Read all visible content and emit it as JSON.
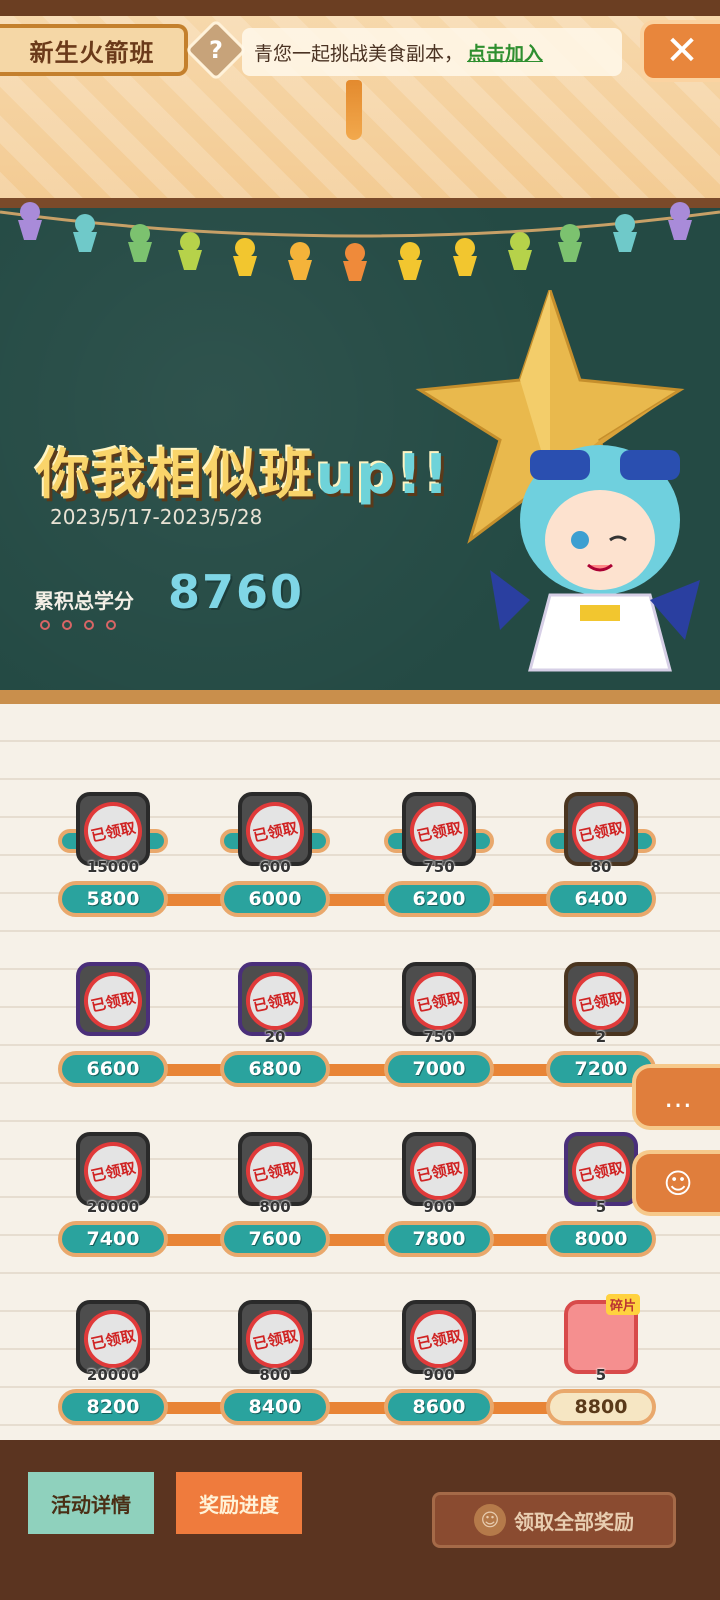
{
  "header": {
    "title": "新生火箭班",
    "help_icon": "?",
    "notice_text": "青您一起挑战美食副本，",
    "notice_link": "点击加入",
    "close_icon": "✕"
  },
  "event": {
    "title_cn": "你我相似班",
    "title_up": "up!!",
    "date_range": "2023/5/17-2023/5/28",
    "score_label": "累积总学分",
    "score_value": "8760"
  },
  "rewards": {
    "rows": [
      {
        "cells": [
          {
            "threshold": "5800",
            "qty": "15000",
            "status": "已领取",
            "frame": "dark"
          },
          {
            "threshold": "6000",
            "qty": "600",
            "status": "已领取",
            "frame": "dark"
          },
          {
            "threshold": "6200",
            "qty": "750",
            "status": "已领取",
            "frame": "dark"
          },
          {
            "threshold": "6400",
            "qty": "80",
            "status": "已领取",
            "frame": "brown"
          }
        ]
      },
      {
        "cells": [
          {
            "threshold": "6600",
            "qty": "",
            "status": "已领取",
            "frame": "purple"
          },
          {
            "threshold": "6800",
            "qty": "20",
            "status": "已领取",
            "frame": "purple"
          },
          {
            "threshold": "7000",
            "qty": "750",
            "status": "已领取",
            "frame": "dark"
          },
          {
            "threshold": "7200",
            "qty": "2",
            "status": "已领取",
            "frame": "brown"
          }
        ]
      },
      {
        "cells": [
          {
            "threshold": "7400",
            "qty": "20000",
            "status": "已领取",
            "frame": "dark"
          },
          {
            "threshold": "7600",
            "qty": "800",
            "status": "已领取",
            "frame": "dark"
          },
          {
            "threshold": "7800",
            "qty": "900",
            "status": "已领取",
            "frame": "dark"
          },
          {
            "threshold": "8000",
            "qty": "5",
            "status": "已领取",
            "frame": "purple"
          }
        ]
      },
      {
        "cells": [
          {
            "threshold": "8200",
            "qty": "20000",
            "status": "已领取",
            "frame": "dark"
          },
          {
            "threshold": "8400",
            "qty": "800",
            "status": "已领取",
            "frame": "dark"
          },
          {
            "threshold": "8600",
            "qty": "900",
            "status": "已领取",
            "frame": "dark"
          },
          {
            "threshold": "8800",
            "qty": "5",
            "status": "",
            "frame": "special",
            "tag": "碎片"
          }
        ]
      }
    ]
  },
  "side_buttons": [
    {
      "icon": "chat-bubble-icon",
      "glyph": "…"
    },
    {
      "icon": "food-icon",
      "glyph": "☺"
    }
  ],
  "bottom_bar": {
    "tab_details": "活动详情",
    "tab_progress": "奖励进度",
    "claim_all": "领取全部奖励",
    "claim_icon": "☺"
  },
  "colors": {
    "board": "#244a44",
    "accent_orange": "#e88436",
    "pill_teal": "#2aa39e",
    "stamp_red": "#e03a3a"
  }
}
